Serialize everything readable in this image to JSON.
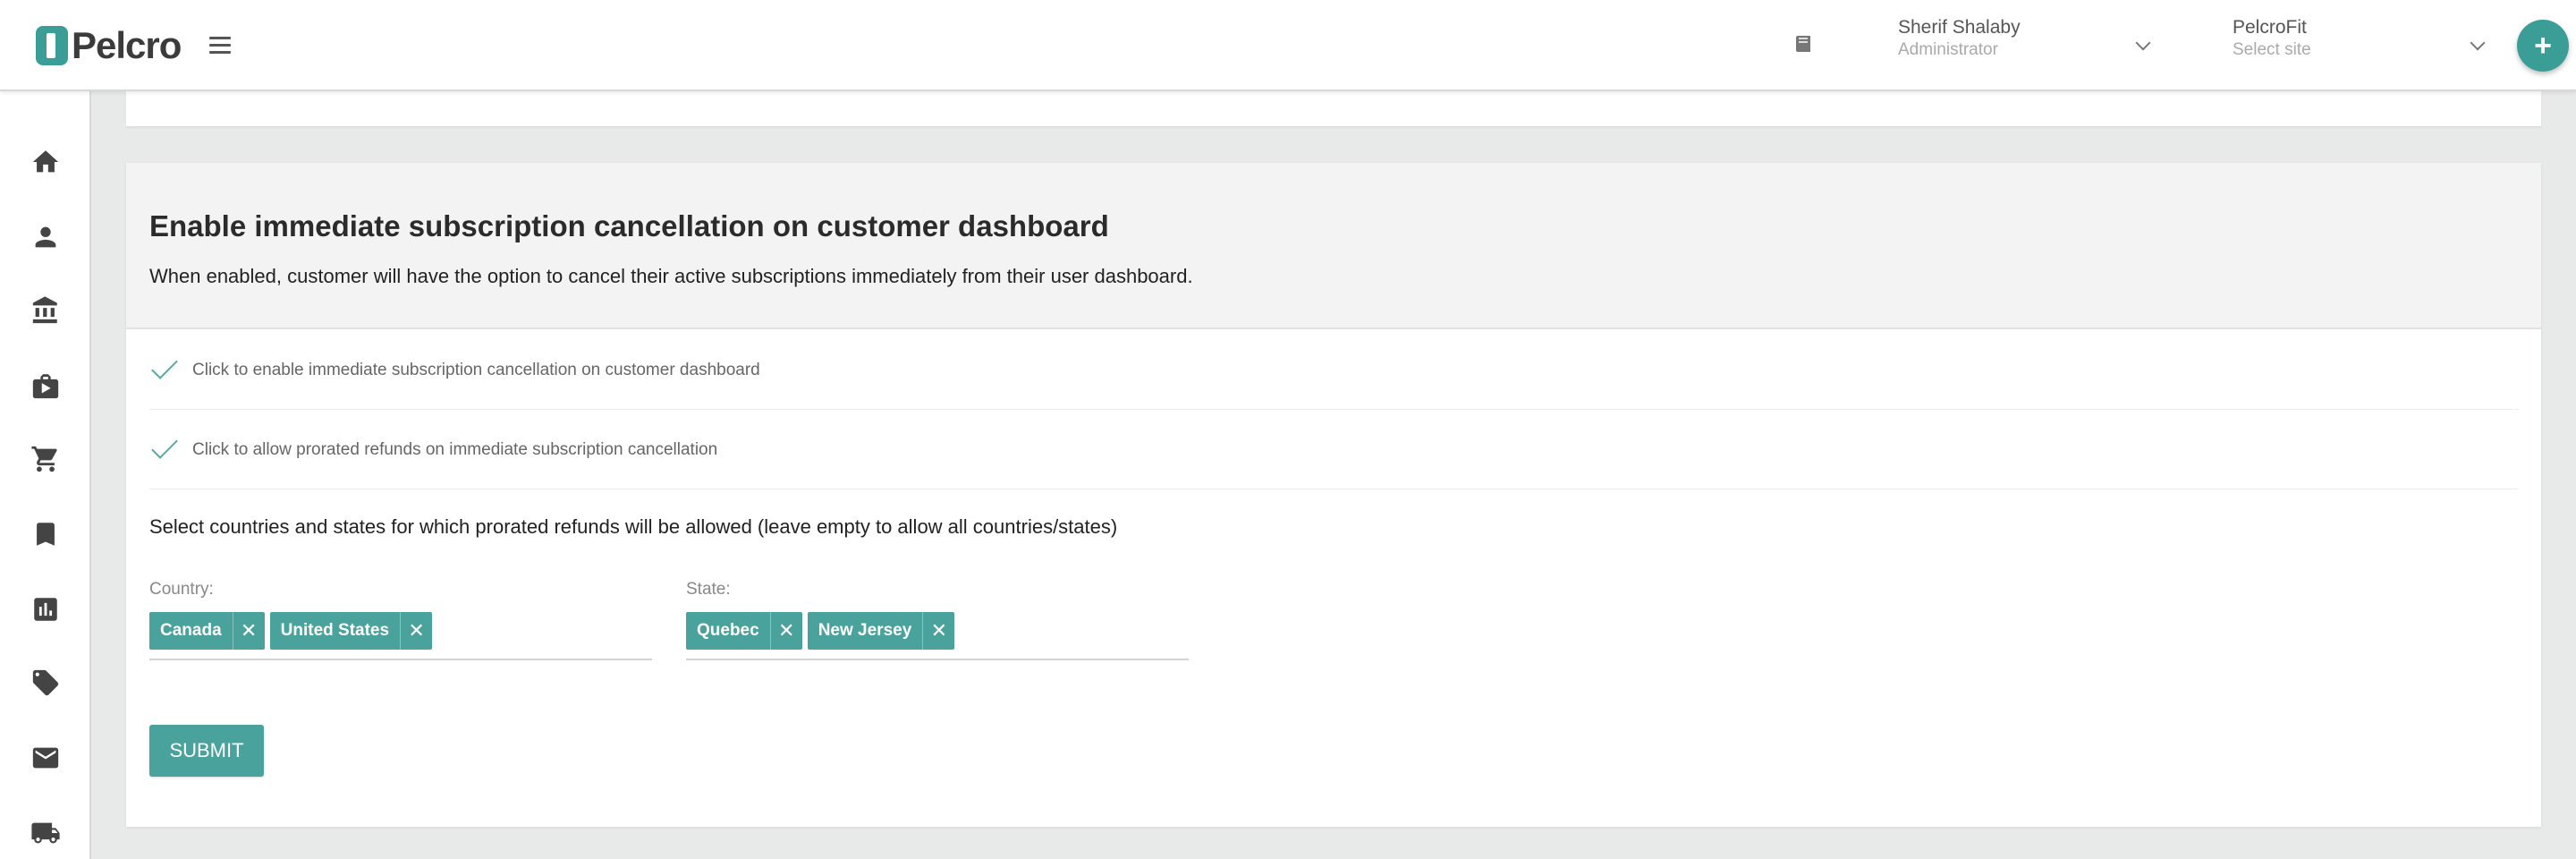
{
  "header": {
    "logo_text": "Pelcro",
    "user": {
      "name": "Sherif Shalaby",
      "role": "Administrator"
    },
    "site": {
      "name": "PelcroFit",
      "placeholder": "Select site"
    },
    "fab_label": "+"
  },
  "sidebar": {
    "items": [
      {
        "icon": "home-icon"
      },
      {
        "icon": "person-icon"
      },
      {
        "icon": "bank-icon"
      },
      {
        "icon": "briefcase-icon"
      },
      {
        "icon": "cart-icon"
      },
      {
        "icon": "bookmark-icon"
      },
      {
        "icon": "bar-chart-icon"
      },
      {
        "icon": "ticket-icon"
      },
      {
        "icon": "mail-icon"
      },
      {
        "icon": "truck-icon"
      }
    ]
  },
  "settings": {
    "title": "Enable immediate subscription cancellation on customer dashboard",
    "description": "When enabled, customer will have the option to cancel their active subscriptions immediately from their user dashboard.",
    "options": [
      {
        "label": "Click to enable immediate subscription cancellation on customer dashboard",
        "checked": true
      },
      {
        "label": "Click to allow prorated refunds on immediate subscription cancellation",
        "checked": true
      }
    ],
    "select_caption": "Select countries and states for which prorated refunds will be allowed (leave empty to allow all countries/states)",
    "country": {
      "label": "Country:",
      "chips": [
        "Canada",
        "United States"
      ]
    },
    "state": {
      "label": "State:",
      "chips": [
        "Quebec",
        "New Jersey"
      ]
    },
    "chip_remove": "✕",
    "submit_label": "SUBMIT"
  },
  "colors": {
    "accent": "#4aa29c",
    "background": "#e8e9e9"
  }
}
